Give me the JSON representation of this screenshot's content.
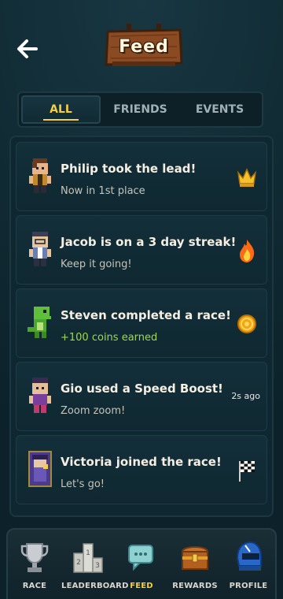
{
  "header": {
    "title": "Feed",
    "back_icon": "arrow-left-icon"
  },
  "tabs": [
    {
      "label": "ALL",
      "active": true
    },
    {
      "label": "FRIENDS",
      "active": false
    },
    {
      "label": "EVENTS",
      "active": false
    }
  ],
  "feed": [
    {
      "title": "Philip took the lead!",
      "subtitle": "Now in 1st place",
      "icon": "crown-icon",
      "avatar": "philip-avatar"
    },
    {
      "title": "Jacob is on a 3 day streak!",
      "subtitle": "Keep it going!",
      "icon": "fire-icon",
      "avatar": "jacob-avatar"
    },
    {
      "title": "Steven completed a race!",
      "subtitle": "+100 coins earned",
      "icon": "coin-icon",
      "avatar": "steven-avatar"
    },
    {
      "title": "Gio used a Speed Boost!",
      "subtitle": "Zoom zoom!",
      "time": "2s ago",
      "avatar": "gio-avatar"
    },
    {
      "title": "Victoria joined the race!",
      "subtitle": "Let's go!",
      "icon": "checkered-flag-icon",
      "avatar": "victoria-avatar"
    }
  ],
  "nav": [
    {
      "label": "RACE",
      "icon": "trophy-icon",
      "active": false
    },
    {
      "label": "LEADERBOARD",
      "icon": "podium-icon",
      "active": false
    },
    {
      "label": "FEED",
      "icon": "chat-bubble-icon",
      "active": true
    },
    {
      "label": "REWARDS",
      "icon": "treasure-chest-icon",
      "active": false
    },
    {
      "label": "PROFILE",
      "icon": "helmet-icon",
      "active": false
    }
  ],
  "colors": {
    "accent": "#f5cf3c",
    "background": "#102a33",
    "panel": "#0f2730",
    "coins_green": "#9fd84a"
  }
}
